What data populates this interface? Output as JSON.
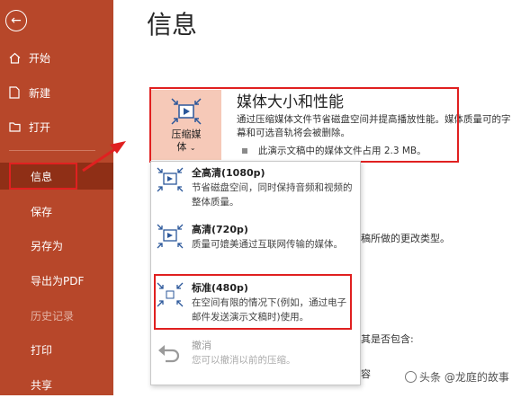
{
  "sidebar": {
    "items": [
      {
        "label": "开始",
        "icon": "home-icon"
      },
      {
        "label": "新建",
        "icon": "new-document-icon"
      },
      {
        "label": "打开",
        "icon": "folder-open-icon"
      },
      {
        "label": "信息"
      },
      {
        "label": "保存"
      },
      {
        "label": "另存为"
      },
      {
        "label": "导出为PDF"
      },
      {
        "label": "历史记录",
        "disabled": true
      },
      {
        "label": "打印"
      },
      {
        "label": "共享"
      }
    ]
  },
  "page": {
    "title": "信息"
  },
  "media": {
    "button_label_1": "压缩媒",
    "button_label_2": "体",
    "title": "媒体大小和性能",
    "description": "通过压缩媒体文件节省磁盘空间并提高播放性能。媒体质量可的字幕和可选音轨将会被删除。",
    "stat": "此演示文稿中的媒体文件占用 2.3 MB。"
  },
  "background_texts": {
    "changes": "稿所做的更改类型。",
    "include": "其是否包含:",
    "content": "容"
  },
  "dropdown": {
    "options": [
      {
        "title": "全高清(1080p)",
        "desc": "节省磁盘空间，同时保持音频和视频的整体质量。"
      },
      {
        "title": "高清(720p)",
        "desc": "质量可媲美通过互联网传输的媒体。"
      },
      {
        "title": "标准(480p)",
        "desc": "在空间有限的情况下(例如，通过电子邮件发送演示文稿时)使用。"
      },
      {
        "title": "撤消",
        "desc": "您可以撤消以前的压缩。"
      }
    ]
  },
  "watermark": {
    "text": "头条 @龙庭的故事"
  },
  "colors": {
    "sidebar": "#b7472a",
    "active": "#8f2f16",
    "highlight": "#e02020",
    "media_button": "#f6c9b8",
    "icon_blue": "#2b579a"
  }
}
